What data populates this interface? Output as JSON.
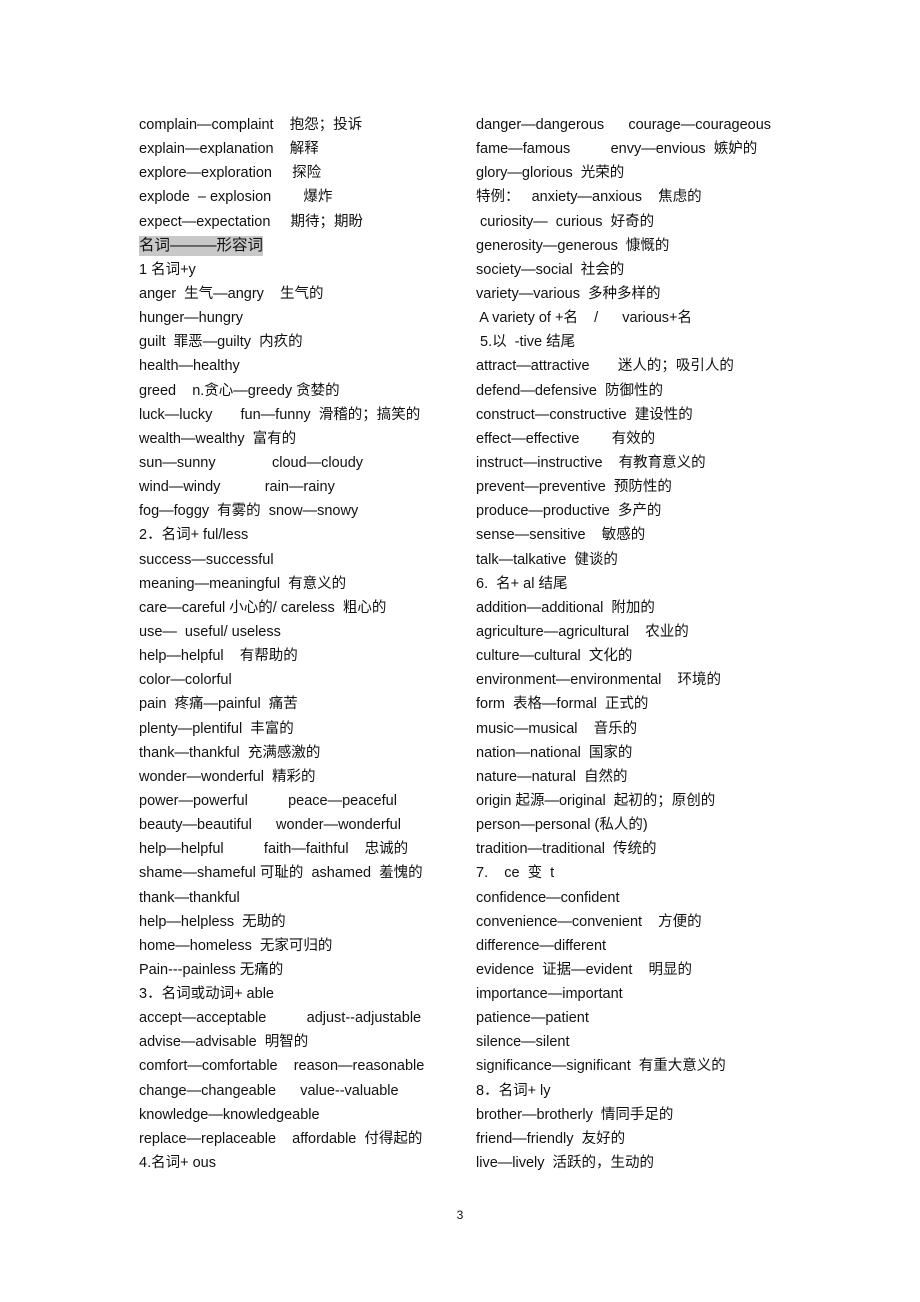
{
  "left_column": [
    {
      "text": "complain—complaint    抱怨；投诉"
    },
    {
      "text": "explain—explanation    解释"
    },
    {
      "text": "explore—exploration     探险"
    },
    {
      "text": "explode  – explosion        爆炸"
    },
    {
      "text": "expect—expectation     期待；期盼"
    },
    {
      "text": "名词———形容词",
      "highlight": true
    },
    {
      "text": "1 名词+y"
    },
    {
      "text": "anger  生气—angry    生气的"
    },
    {
      "text": "hunger—hungry"
    },
    {
      "text": "guilt  罪恶—guilty  内疚的"
    },
    {
      "text": "health—healthy"
    },
    {
      "text": "greed    n.贪心—greedy 贪婪的"
    },
    {
      "text": "luck—lucky       fun—funny  滑稽的；搞笑的"
    },
    {
      "text": "wealth—wealthy  富有的"
    },
    {
      "text": "sun—sunny              cloud—cloudy"
    },
    {
      "text": "wind—windy           rain—rainy"
    },
    {
      "text": "fog—foggy  有雾的  snow—snowy"
    },
    {
      "text": "2．名词+ ful/less"
    },
    {
      "text": "success—successful"
    },
    {
      "text": "meaning—meaningful  有意义的"
    },
    {
      "text": "care—careful 小心的/ careless  粗心的"
    },
    {
      "text": "use—  useful/ useless"
    },
    {
      "text": "help—helpful    有帮助的"
    },
    {
      "text": "color—colorful"
    },
    {
      "text": "pain  疼痛—painful  痛苦"
    },
    {
      "text": "plenty—plentiful  丰富的"
    },
    {
      "text": "thank—thankful  充满感激的"
    },
    {
      "text": "wonder—wonderful  精彩的"
    },
    {
      "text": "power—powerful          peace—peaceful"
    },
    {
      "text": "beauty—beautiful      wonder—wonderful"
    },
    {
      "text": "help—helpful          faith—faithful    忠诚的"
    },
    {
      "text": "shame—shameful 可耻的  ashamed  羞愧的"
    },
    {
      "text": "thank—thankful"
    },
    {
      "text": "help—helpless  无助的"
    },
    {
      "text": "home—homeless  无家可归的"
    },
    {
      "text": "Pain---painless 无痛的"
    },
    {
      "text": "3．名词或动词+ able"
    },
    {
      "text": "accept—acceptable          adjust--adjustable"
    },
    {
      "text": "advise—advisable  明智的"
    },
    {
      "text": "comfort—comfortable    reason—reasonable"
    },
    {
      "text": "change—changeable      value--valuable"
    },
    {
      "text": "knowledge—knowledgeable"
    },
    {
      "text": "replace—replaceable    affordable  付得起的"
    },
    {
      "text": "4.名词+ ous"
    }
  ],
  "right_column": [
    {
      "text": "danger—dangerous      courage—courageous"
    },
    {
      "text": "fame—famous          envy—envious  嫉妒的"
    },
    {
      "text": "glory—glorious  光荣的"
    },
    {
      "text": "特例：   anxiety—anxious    焦虑的"
    },
    {
      "text": " curiosity—  curious  好奇的"
    },
    {
      "text": "generosity—generous  慷慨的"
    },
    {
      "text": "society—social  社会的"
    },
    {
      "text": "variety—various  多种多样的"
    },
    {
      "text": " A variety of +名    /      various+名"
    },
    {
      "text": " 5.以  -tive 结尾"
    },
    {
      "text": "attract—attractive       迷人的；吸引人的"
    },
    {
      "text": "defend—defensive  防御性的"
    },
    {
      "text": "construct—constructive  建设性的"
    },
    {
      "text": "effect—effective        有效的"
    },
    {
      "text": "instruct—instructive    有教育意义的"
    },
    {
      "text": "prevent—preventive  预防性的"
    },
    {
      "text": "produce—productive  多产的"
    },
    {
      "text": "sense—sensitive    敏感的"
    },
    {
      "text": "talk—talkative  健谈的"
    },
    {
      "text": "6.  名+ al 结尾"
    },
    {
      "text": "addition—additional  附加的"
    },
    {
      "text": "agriculture—agricultural    农业的"
    },
    {
      "text": "culture—cultural  文化的"
    },
    {
      "text": "environment—environmental    环境的"
    },
    {
      "text": "form  表格—formal  正式的"
    },
    {
      "text": "music—musical    音乐的"
    },
    {
      "text": "nation—national  国家的"
    },
    {
      "text": "nature—natural  自然的"
    },
    {
      "text": "origin 起源—original  起初的；原创的"
    },
    {
      "text": "person—personal (私人的)"
    },
    {
      "text": "tradition—traditional  传统的"
    },
    {
      "text": "7.    ce  变  t"
    },
    {
      "text": "confidence—confident"
    },
    {
      "text": "convenience—convenient    方便的"
    },
    {
      "text": "difference—different"
    },
    {
      "text": "evidence  证据—evident    明显的"
    },
    {
      "text": "importance—important"
    },
    {
      "text": "patience—patient"
    },
    {
      "text": "silence—silent"
    },
    {
      "text": "significance—significant  有重大意义的"
    },
    {
      "text": "8．名词+ ly"
    },
    {
      "text": "brother—brotherly  情同手足的"
    },
    {
      "text": "friend—friendly  友好的"
    },
    {
      "text": "live—lively  活跃的，生动的"
    }
  ],
  "footer": {
    "page_number": "3"
  },
  "colors": {
    "highlight": "#c8c8c8",
    "text": "#111111"
  }
}
